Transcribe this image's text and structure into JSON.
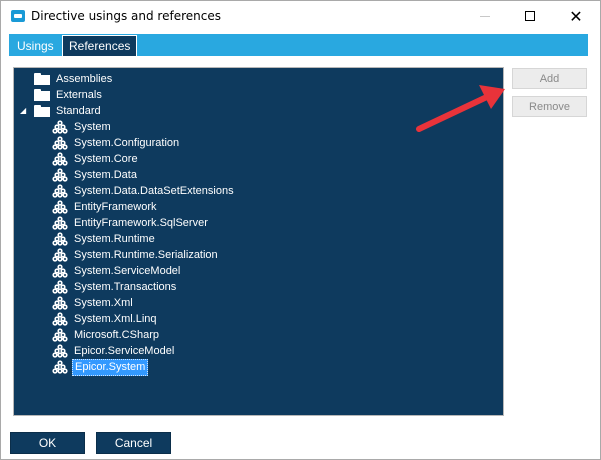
{
  "window": {
    "title": "Directive usings and references",
    "icon": "app-window-icon"
  },
  "tabs": [
    {
      "label": "Usings",
      "active": false
    },
    {
      "label": "References",
      "active": true
    }
  ],
  "tree": {
    "folders": [
      {
        "label": "Assemblies",
        "expanded": false
      },
      {
        "label": "Externals",
        "expanded": false
      },
      {
        "label": "Standard",
        "expanded": true
      }
    ],
    "assemblies": [
      {
        "label": "System",
        "selected": false
      },
      {
        "label": "System.Configuration",
        "selected": false
      },
      {
        "label": "System.Core",
        "selected": false
      },
      {
        "label": "System.Data",
        "selected": false
      },
      {
        "label": "System.Data.DataSetExtensions",
        "selected": false
      },
      {
        "label": "EntityFramework",
        "selected": false
      },
      {
        "label": "EntityFramework.SqlServer",
        "selected": false
      },
      {
        "label": "System.Runtime",
        "selected": false
      },
      {
        "label": "System.Runtime.Serialization",
        "selected": false
      },
      {
        "label": "System.ServiceModel",
        "selected": false
      },
      {
        "label": "System.Transactions",
        "selected": false
      },
      {
        "label": "System.Xml",
        "selected": false
      },
      {
        "label": "System.Xml.Linq",
        "selected": false
      },
      {
        "label": "Microsoft.CSharp",
        "selected": false
      },
      {
        "label": "Epicor.ServiceModel",
        "selected": false
      },
      {
        "label": "Epicor.System",
        "selected": true
      }
    ]
  },
  "side_buttons": {
    "add_label": "Add",
    "remove_label": "Remove"
  },
  "footer": {
    "ok_label": "OK",
    "cancel_label": "Cancel"
  },
  "colors": {
    "tree_background": "#0e3a5e",
    "tab_bar": "#29a8e0",
    "selection": "#3399ff",
    "annotation_arrow": "#e8333a",
    "primary_button": "#0e3a5e"
  }
}
